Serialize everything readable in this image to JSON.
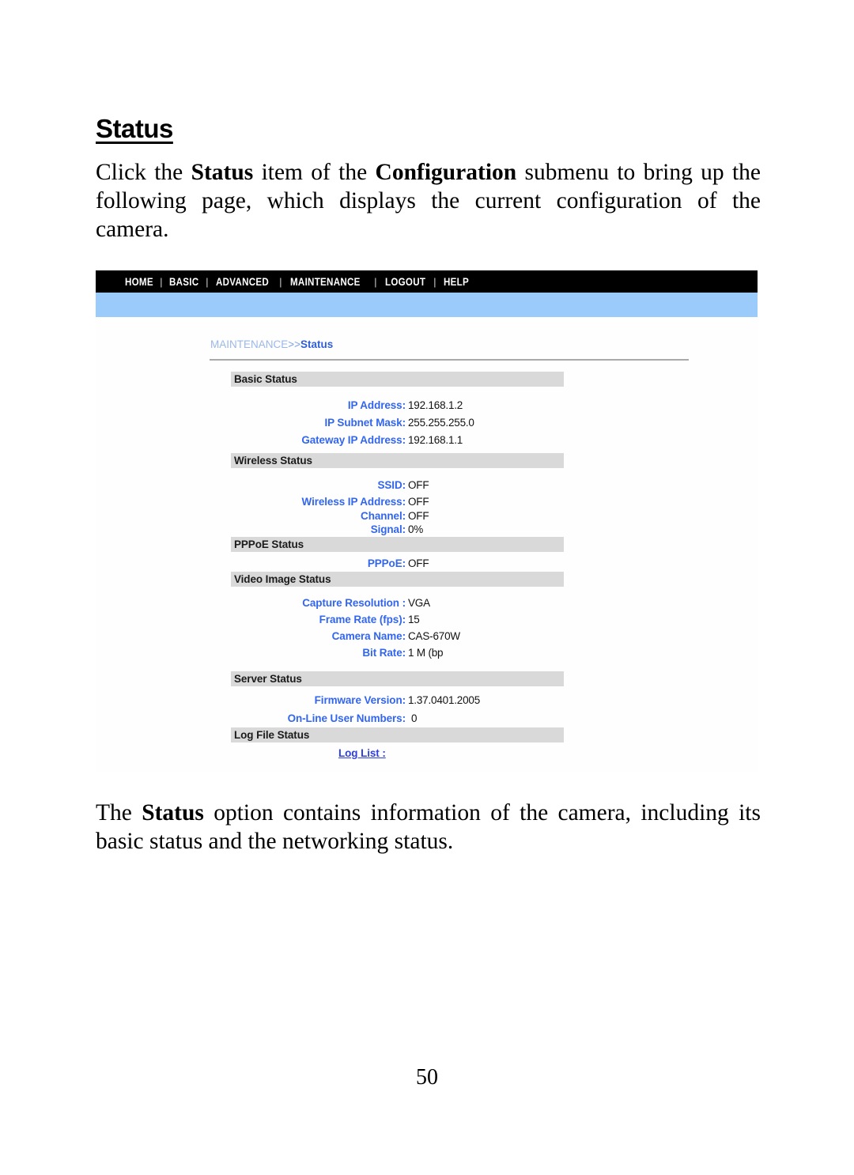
{
  "document": {
    "heading": "Status",
    "intro_paragraph": {
      "part1": "Click the ",
      "bold1": "Status",
      "part2": " item of the ",
      "bold2": "Configuration",
      "part3": " submenu to bring up the following page, which displays the current configuration of the camera."
    },
    "outro_paragraph": {
      "part1": "The ",
      "bold1": "Status",
      "part2": " option contains information of the camera, including its basic status and the networking status."
    },
    "page_number": "50"
  },
  "screenshot": {
    "nav": {
      "items": [
        {
          "label": "HOME"
        },
        {
          "label": "BASIC"
        },
        {
          "label": "ADVANCED"
        },
        {
          "label": "MAINTENANCE"
        },
        {
          "label": "LOGOUT"
        },
        {
          "label": "HELP"
        }
      ],
      "separator": "|"
    },
    "breadcrumb": {
      "parent": "MAINTENANCE",
      "separator": ">>",
      "current": "Status"
    },
    "sections": [
      {
        "title": "Basic Status",
        "rows": [
          {
            "label": "IP Address:",
            "value": "192.168.1.2"
          },
          {
            "label": "IP Subnet Mask:",
            "value": "255.255.255.0"
          },
          {
            "label": "Gateway IP Address:",
            "value": "192.168.1.1"
          }
        ]
      },
      {
        "title": "Wireless Status",
        "rows": [
          {
            "label": "SSID:",
            "value": "OFF"
          },
          {
            "label": "Wireless IP Address:",
            "value": "OFF"
          },
          {
            "label": "Channel:",
            "value": "OFF"
          },
          {
            "label": "Signal:",
            "value": "0%"
          }
        ]
      },
      {
        "title": "PPPoE Status",
        "rows": [
          {
            "label": "PPPoE:",
            "value": "OFF"
          }
        ]
      },
      {
        "title": "Video Image Status",
        "rows": [
          {
            "label": "Capture Resolution :",
            "value": "VGA"
          },
          {
            "label": "Frame Rate (fps):",
            "value": "15"
          },
          {
            "label": "Camera Name:",
            "value": "CAS-670W"
          },
          {
            "label": "Bit Rate:",
            "value": "1 M (bp"
          }
        ]
      },
      {
        "title": "Server Status",
        "rows": [
          {
            "label": "Firmware Version:",
            "value": "1.37.0401.2005"
          },
          {
            "label": "On-Line User Numbers:",
            "value": "0"
          }
        ]
      },
      {
        "title": "Log File Status",
        "rows": [
          {
            "link": "Log List :"
          }
        ]
      }
    ],
    "colors": {
      "nav_background": "#000000",
      "nav_text": "#ffffff",
      "accent_band": "#9bcbfb",
      "label_blue": "#3366ee",
      "link_blue": "#2f3fe0",
      "section_header_background": "#d9d9d9"
    }
  }
}
